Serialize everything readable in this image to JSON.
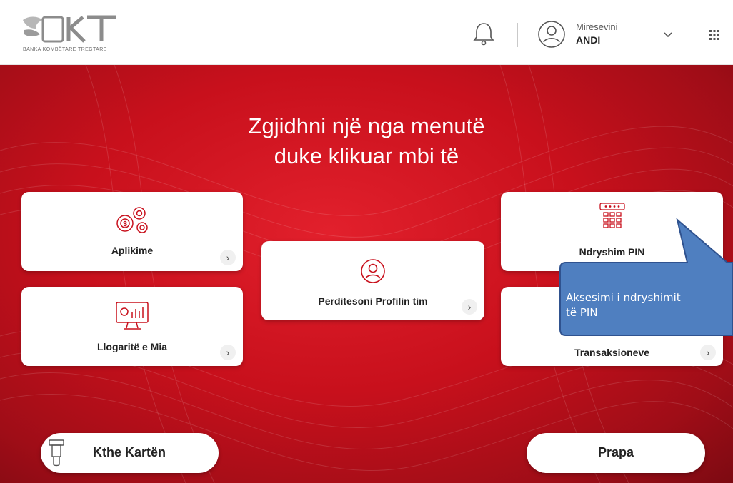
{
  "header": {
    "bank_name": "BANKA KOMBËTARE TREGTARE",
    "greeting": "Mirësevini",
    "user_name": "ANDI",
    "icons": {
      "bell": "bell-icon",
      "avatar": "user-avatar-icon",
      "dropdown": "chevron-down-icon",
      "apps": "apps-grid-icon"
    }
  },
  "hero": {
    "headline_line1": "Zgjidhni një nga menutë",
    "headline_line2": "duke klikuar mbi të"
  },
  "menu": {
    "applications": "Aplikime",
    "accounts": "Llogaritë e Mia",
    "update_profile": "Perditesoni Profilin tim",
    "change_pin": "Ndryshim PIN",
    "transactions": "Transaksioneve"
  },
  "buttons": {
    "return_card": "Kthe Kartën",
    "back": "Prapa",
    "arrow_glyph": "›"
  },
  "callout": {
    "line1": "Aksesimi i ndryshimit",
    "line2": "të PIN"
  },
  "colors": {
    "brand_red": "#c8101c",
    "callout_blue": "#4f7fc0",
    "callout_border": "#2f528f"
  }
}
